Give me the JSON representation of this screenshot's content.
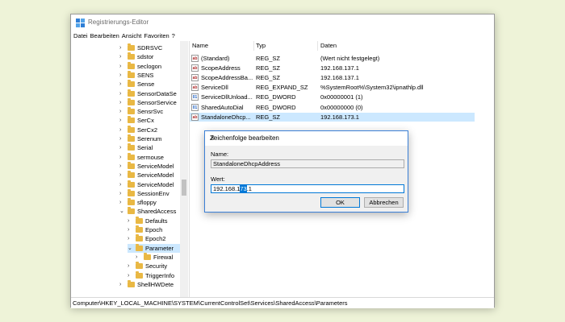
{
  "window": {
    "title": "Registrierungs-Editor"
  },
  "menu": [
    "Datei",
    "Bearbeiten",
    "Ansicht",
    "Favoriten",
    "?"
  ],
  "tree": [
    {
      "label": "SDRSVC",
      "level": 0
    },
    {
      "label": "sdstor",
      "level": 0
    },
    {
      "label": "seclogon",
      "level": 0
    },
    {
      "label": "SENS",
      "level": 0
    },
    {
      "label": "Sense",
      "level": 0
    },
    {
      "label": "SensorDataSe",
      "level": 0
    },
    {
      "label": "SensorService",
      "level": 0
    },
    {
      "label": "SensrSvc",
      "level": 0
    },
    {
      "label": "SerCx",
      "level": 0
    },
    {
      "label": "SerCx2",
      "level": 0
    },
    {
      "label": "Serenum",
      "level": 0
    },
    {
      "label": "Serial",
      "level": 0
    },
    {
      "label": "sermouse",
      "level": 0
    },
    {
      "label": "ServiceModel",
      "level": 0
    },
    {
      "label": "ServiceModel",
      "level": 0
    },
    {
      "label": "ServiceModel",
      "level": 0
    },
    {
      "label": "SessionEnv",
      "level": 0
    },
    {
      "label": "sfloppy",
      "level": 0
    },
    {
      "label": "SharedAccess",
      "level": 0,
      "expanded": true
    },
    {
      "label": "Defaults",
      "level": 1
    },
    {
      "label": "Epoch",
      "level": 1
    },
    {
      "label": "Epoch2",
      "level": 1
    },
    {
      "label": "Parameter",
      "level": 1,
      "expanded": true,
      "selected": true
    },
    {
      "label": "Firewal",
      "level": 2
    },
    {
      "label": "Security",
      "level": 1
    },
    {
      "label": "TriggerInfo",
      "level": 1
    },
    {
      "label": "ShellHWDete",
      "level": 0
    }
  ],
  "columns": [
    "Name",
    "Typ",
    "Daten"
  ],
  "values": [
    {
      "name": "(Standard)",
      "type": "REG_SZ",
      "data": "(Wert nicht festgelegt)",
      "icon": "ab"
    },
    {
      "name": "ScopeAddress",
      "type": "REG_SZ",
      "data": "192.168.137.1",
      "icon": "ab"
    },
    {
      "name": "ScopeAddressBa...",
      "type": "REG_SZ",
      "data": "192.168.137.1",
      "icon": "ab"
    },
    {
      "name": "ServiceDll",
      "type": "REG_EXPAND_SZ",
      "data": "%SystemRoot%\\System32\\ipnathlp.dll",
      "icon": "ab"
    },
    {
      "name": "ServiceDllUnload...",
      "type": "REG_DWORD",
      "data": "0x00000001 (1)",
      "icon": "dw"
    },
    {
      "name": "SharedAutoDial",
      "type": "REG_DWORD",
      "data": "0x00000000 (0)",
      "icon": "dw"
    },
    {
      "name": "StandaloneDhcp...",
      "type": "REG_SZ",
      "data": "192.168.173.1",
      "icon": "ab",
      "selected": true
    }
  ],
  "status": "Computer\\HKEY_LOCAL_MACHINE\\SYSTEM\\CurrentControlSet\\Services\\SharedAccess\\Parameters",
  "dialog": {
    "title": "Zeichenfolge bearbeiten",
    "name_label": "Name:",
    "name_value": "StandaloneDhcpAddress",
    "value_label": "Wert:",
    "value_pre": "192.168.1",
    "value_sel": "73",
    "value_post": ".1",
    "ok": "OK",
    "cancel": "Abbrechen"
  }
}
